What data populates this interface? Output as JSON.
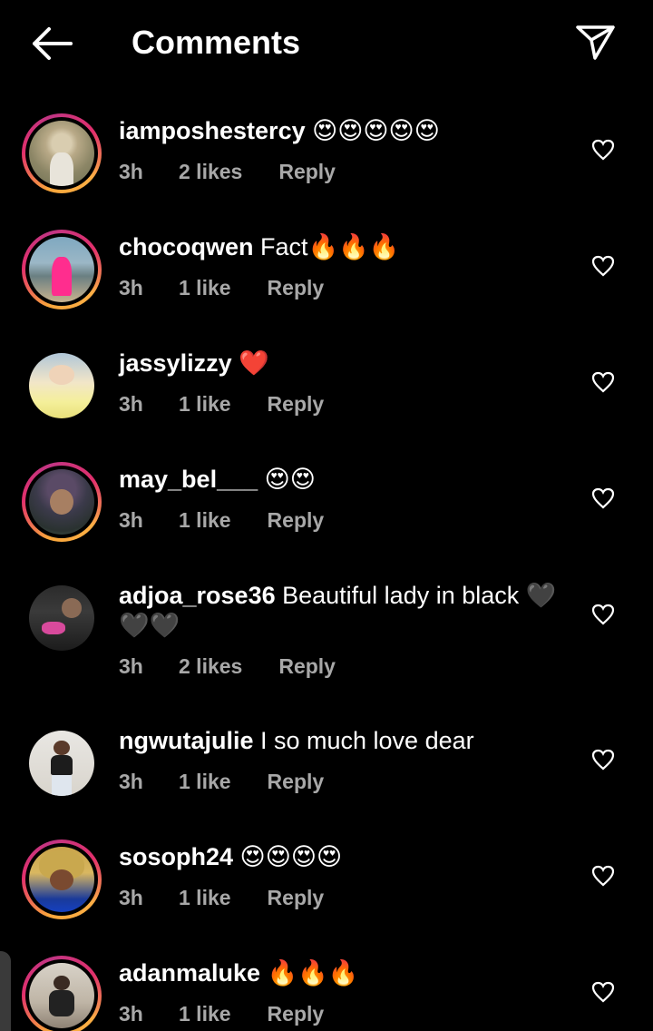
{
  "header": {
    "title": "Comments",
    "back_icon": "arrow-left-icon",
    "share_icon": "paper-plane-icon"
  },
  "colors": {
    "background": "#000000",
    "text": "#ffffff",
    "meta": "#a8a8a8",
    "ring_start": "#f9a63b",
    "ring_end": "#e1306c",
    "heart_red": "#e0202b"
  },
  "comments": [
    {
      "username": "iamposhestercy",
      "text": " 😍😍😍😍😍",
      "time": "3h",
      "likes": "2 likes",
      "reply": "Reply"
    },
    {
      "username": "chocoqwen",
      "text": " Fact🔥🔥🔥",
      "time": "3h",
      "likes": "1 like",
      "reply": "Reply"
    },
    {
      "username": "jassylizzy",
      "text": " ❤️",
      "time": "3h",
      "likes": "1 like",
      "reply": "Reply"
    },
    {
      "username": "may_bel___",
      "text": " 😍😍",
      "time": "3h",
      "likes": "1 like",
      "reply": "Reply"
    },
    {
      "username": "adjoa_rose36",
      "text": " Beautiful lady in black 🖤🖤🖤",
      "time": "3h",
      "likes": "2 likes",
      "reply": "Reply"
    },
    {
      "username": "ngwutajulie",
      "text": " I so much love dear",
      "time": "3h",
      "likes": "1 like",
      "reply": "Reply"
    },
    {
      "username": "sosoph24",
      "text": " 😍😍😍😍",
      "time": "3h",
      "likes": "1 like",
      "reply": "Reply"
    },
    {
      "username": "adanmaluke",
      "text": " 🔥🔥🔥",
      "time": "3h",
      "likes": "1 like",
      "reply": "Reply"
    }
  ]
}
